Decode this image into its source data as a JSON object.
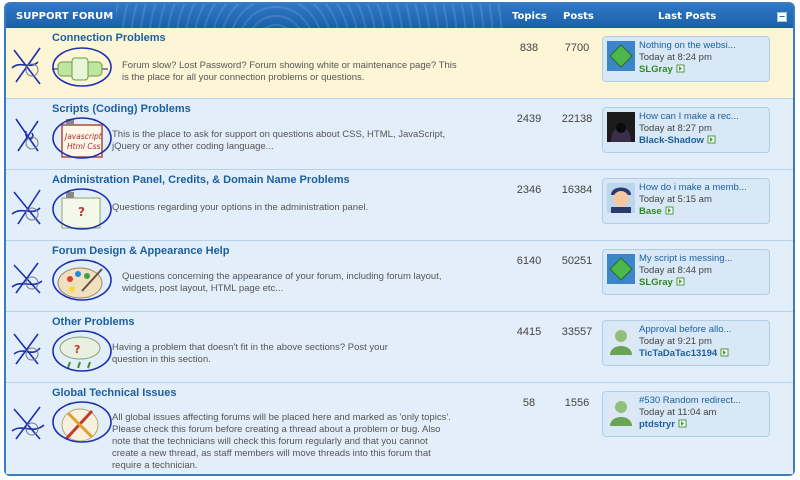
{
  "header": {
    "title": "SUPPORT FORUM",
    "col_topics": "Topics",
    "col_posts": "Posts",
    "col_last": "Last Posts",
    "collapse_glyph": "−"
  },
  "forums": [
    {
      "title": "Connection Problems",
      "description": "Forum slow? Lost Password? Forum showing white or maintenance page? This is the place for all your connection problems or questions.",
      "topics": "838",
      "posts": "7700",
      "icon": "connection-plug-icon",
      "last_post": {
        "title": "Nothing on the websi...",
        "time": "Today at 8:24 pm",
        "user": "SLGray",
        "user_color": "#2e8b1e",
        "avatar": "green-diamond-avatar"
      }
    },
    {
      "title": "Scripts (Coding) Problems",
      "description": "This is the place to ask for support on questions about CSS, HTML, JavaScript, jQuery or any other coding language...",
      "topics": "2439",
      "posts": "22138",
      "icon": "script-document-icon",
      "icon_text_1": "Javascript",
      "icon_text_2": "Html Css",
      "last_post": {
        "title": "How can I make a rec...",
        "time": "Today at 8:27 pm",
        "user": "Black-Shadow",
        "user_color": "#1c5f9f",
        "avatar": "hooded-figure-avatar"
      }
    },
    {
      "title": "Administration Panel, Credits, & Domain Name Problems",
      "description": "Questions regarding your options in the administration panel.",
      "topics": "2346",
      "posts": "16384",
      "icon": "admin-panel-icon",
      "last_post": {
        "title": "How do i make a memb...",
        "time": "Today at 5:15 am",
        "user": "Base",
        "user_color": "#2e8b1e",
        "avatar": "cartoon-face-avatar"
      }
    },
    {
      "title": "Forum Design & Appearance Help",
      "description": "Questions concerning the appearance of your forum, including forum layout, widgets, post layout, HTML page etc...",
      "topics": "6140",
      "posts": "50251",
      "icon": "paint-palette-icon",
      "last_post": {
        "title": "My script is messing...",
        "time": "Today at 8:44 pm",
        "user": "SLGray",
        "user_color": "#2e8b1e",
        "avatar": "green-diamond-avatar"
      }
    },
    {
      "title": "Other Problems",
      "description": "Having a problem that doesn't fit in the above sections? Post your question in this section.",
      "topics": "4415",
      "posts": "33557",
      "icon": "question-cloud-icon",
      "last_post": {
        "title": "Approval before allo...",
        "time": "Today at 9:21 pm",
        "user": "TicTaDaTac13194",
        "user_color": "#1c5f9f",
        "avatar": "default-user-avatar"
      }
    },
    {
      "title": "Global Technical Issues",
      "description": "All global issues affecting forums will be placed here and marked as 'only topics'. Please check this forum before creating a thread about a problem or bug. Also note that the technicians will check this forum regularly and that you cannot create a new thread, as staff members will move threads into this forum that require a technician.",
      "topics": "58",
      "posts": "1556",
      "icon": "tools-icon",
      "last_post": {
        "title": "#530 Random redirect...",
        "time": "Today at 11:04 am",
        "user": "ptdstryr",
        "user_color": "#1c5f9f",
        "avatar": "default-user-avatar"
      }
    }
  ]
}
